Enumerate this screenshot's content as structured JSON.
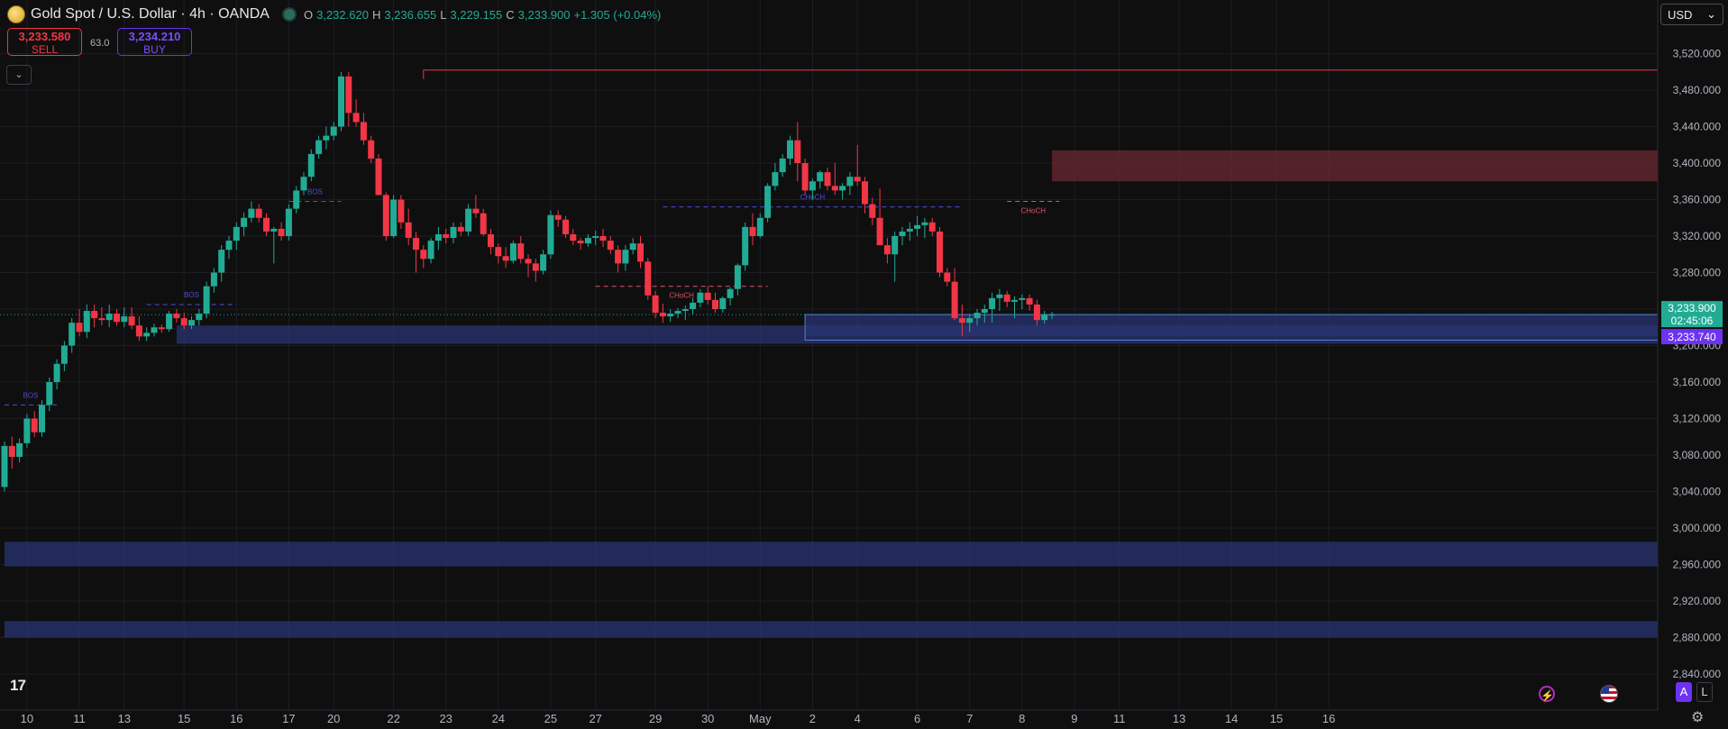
{
  "header": {
    "symbol": "Gold Spot / U.S. Dollar · 4h · OANDA",
    "open_label": "O",
    "open": "3,232.620",
    "high_label": "H",
    "high": "3,236.655",
    "low_label": "L",
    "low": "3,229.155",
    "close_label": "C",
    "close": "3,233.900",
    "change": "+1.305 (+0.04%)"
  },
  "trade": {
    "sell_price": "3,233.580",
    "sell_label": "SELL",
    "spread": "63.0",
    "buy_price": "3,234.210",
    "buy_label": "BUY"
  },
  "currency": "USD",
  "icons": {
    "collapse": "chevron-down-icon",
    "brand": "tradingview-logo",
    "bolt": "lightning-icon",
    "flag": "us-flag-icon",
    "settings": "gear-icon"
  },
  "labels": {
    "tv": "17",
    "auto": "A",
    "log": "L",
    "bolt": "⚡",
    "gear": "⚙"
  },
  "colors": {
    "up": "#22ab94",
    "down": "#f23645",
    "zone_blue": "#2a3472",
    "zone_red": "#6b2a30",
    "structure": "#4b4fd8",
    "accent": "#6d32f2"
  },
  "chart_data": {
    "type": "candlestick",
    "timeframe": "4h",
    "ylim": [
      2830,
      3540
    ],
    "y_ticks": [
      2840,
      2880,
      2920,
      2960,
      3000,
      3040,
      3080,
      3120,
      3160,
      3200,
      3240,
      3280,
      3320,
      3360,
      3400,
      3440,
      3480,
      3520
    ],
    "y_tick_labels": [
      "2,840.000",
      "2,880.000",
      "2,920.000",
      "2,960.000",
      "3,000.000",
      "3,040.000",
      "3,080.000",
      "3,120.000",
      "3,160.000",
      "3,200.000",
      "3,240.000",
      "3,280.000",
      "3,320.000",
      "3,360.000",
      "3,400.000",
      "3,440.000",
      "3,480.000",
      "3,520.000"
    ],
    "x_labels": [
      {
        "label": "10",
        "i": 3
      },
      {
        "label": "11",
        "i": 10
      },
      {
        "label": "13",
        "i": 16
      },
      {
        "label": "15",
        "i": 24
      },
      {
        "label": "16",
        "i": 31
      },
      {
        "label": "17",
        "i": 38
      },
      {
        "label": "20",
        "i": 44
      },
      {
        "label": "22",
        "i": 52
      },
      {
        "label": "23",
        "i": 59
      },
      {
        "label": "24",
        "i": 66
      },
      {
        "label": "25",
        "i": 73
      },
      {
        "label": "27",
        "i": 79
      },
      {
        "label": "29",
        "i": 87
      },
      {
        "label": "30",
        "i": 94
      },
      {
        "label": "May",
        "i": 101
      },
      {
        "label": "2",
        "i": 108
      },
      {
        "label": "4",
        "i": 114
      },
      {
        "label": "6",
        "i": 122
      },
      {
        "label": "7",
        "i": 129
      },
      {
        "label": "8",
        "i": 136
      },
      {
        "label": "9",
        "i": 143
      },
      {
        "label": "11",
        "i": 149
      },
      {
        "label": "13",
        "i": 157
      },
      {
        "label": "14",
        "i": 164
      },
      {
        "label": "15",
        "i": 170
      },
      {
        "label": "16",
        "i": 177
      }
    ],
    "candles": [
      [
        3045,
        3095,
        3040,
        3090
      ],
      [
        3090,
        3100,
        3065,
        3078
      ],
      [
        3078,
        3098,
        3072,
        3093
      ],
      [
        3093,
        3125,
        3088,
        3120
      ],
      [
        3120,
        3128,
        3100,
        3105
      ],
      [
        3105,
        3140,
        3100,
        3135
      ],
      [
        3135,
        3165,
        3128,
        3160
      ],
      [
        3160,
        3185,
        3152,
        3180
      ],
      [
        3180,
        3205,
        3172,
        3200
      ],
      [
        3200,
        3230,
        3192,
        3225
      ],
      [
        3225,
        3240,
        3210,
        3215
      ],
      [
        3215,
        3245,
        3208,
        3238
      ],
      [
        3238,
        3245,
        3220,
        3230
      ],
      [
        3230,
        3242,
        3222,
        3228
      ],
      [
        3228,
        3245,
        3220,
        3235
      ],
      [
        3235,
        3240,
        3222,
        3226
      ],
      [
        3226,
        3242,
        3220,
        3232
      ],
      [
        3232,
        3242,
        3218,
        3222
      ],
      [
        3222,
        3232,
        3205,
        3210
      ],
      [
        3210,
        3220,
        3205,
        3214
      ],
      [
        3214,
        3224,
        3210,
        3220
      ],
      [
        3220,
        3223,
        3214,
        3218
      ],
      [
        3218,
        3238,
        3215,
        3235
      ],
      [
        3235,
        3240,
        3225,
        3230
      ],
      [
        3230,
        3236,
        3218,
        3222
      ],
      [
        3222,
        3232,
        3218,
        3228
      ],
      [
        3228,
        3240,
        3222,
        3235
      ],
      [
        3235,
        3270,
        3230,
        3265
      ],
      [
        3265,
        3285,
        3258,
        3280
      ],
      [
        3280,
        3310,
        3270,
        3305
      ],
      [
        3305,
        3320,
        3295,
        3315
      ],
      [
        3315,
        3335,
        3305,
        3330
      ],
      [
        3330,
        3346,
        3320,
        3340
      ],
      [
        3340,
        3358,
        3335,
        3350
      ],
      [
        3350,
        3355,
        3335,
        3340
      ],
      [
        3340,
        3345,
        3320,
        3325
      ],
      [
        3325,
        3330,
        3290,
        3328
      ],
      [
        3328,
        3335,
        3315,
        3320
      ],
      [
        3320,
        3355,
        3315,
        3350
      ],
      [
        3350,
        3375,
        3345,
        3370
      ],
      [
        3370,
        3390,
        3365,
        3385
      ],
      [
        3385,
        3415,
        3380,
        3410
      ],
      [
        3410,
        3430,
        3405,
        3425
      ],
      [
        3425,
        3440,
        3415,
        3430
      ],
      [
        3430,
        3445,
        3425,
        3440
      ],
      [
        3440,
        3500,
        3435,
        3495
      ],
      [
        3495,
        3500,
        3440,
        3455
      ],
      [
        3455,
        3470,
        3440,
        3445
      ],
      [
        3445,
        3455,
        3420,
        3425
      ],
      [
        3425,
        3430,
        3400,
        3405
      ],
      [
        3405,
        3410,
        3370,
        3365
      ],
      [
        3365,
        3368,
        3315,
        3320
      ],
      [
        3320,
        3365,
        3318,
        3360
      ],
      [
        3360,
        3365,
        3328,
        3335
      ],
      [
        3335,
        3350,
        3310,
        3318
      ],
      [
        3318,
        3325,
        3280,
        3305
      ],
      [
        3305,
        3310,
        3285,
        3295
      ],
      [
        3295,
        3318,
        3290,
        3315
      ],
      [
        3315,
        3330,
        3305,
        3322
      ],
      [
        3322,
        3328,
        3312,
        3318
      ],
      [
        3318,
        3335,
        3312,
        3330
      ],
      [
        3330,
        3335,
        3320,
        3325
      ],
      [
        3325,
        3355,
        3320,
        3350
      ],
      [
        3350,
        3365,
        3340,
        3345
      ],
      [
        3345,
        3350,
        3320,
        3322
      ],
      [
        3322,
        3328,
        3300,
        3308
      ],
      [
        3308,
        3312,
        3290,
        3298
      ],
      [
        3298,
        3308,
        3285,
        3293
      ],
      [
        3293,
        3315,
        3290,
        3312
      ],
      [
        3312,
        3320,
        3290,
        3295
      ],
      [
        3295,
        3300,
        3275,
        3290
      ],
      [
        3290,
        3295,
        3270,
        3282
      ],
      [
        3282,
        3305,
        3278,
        3300
      ],
      [
        3300,
        3348,
        3295,
        3343
      ],
      [
        3343,
        3348,
        3330,
        3338
      ],
      [
        3338,
        3342,
        3318,
        3322
      ],
      [
        3322,
        3328,
        3310,
        3315
      ],
      [
        3315,
        3318,
        3305,
        3312
      ],
      [
        3312,
        3322,
        3308,
        3318
      ],
      [
        3318,
        3326,
        3310,
        3320
      ],
      [
        3320,
        3328,
        3308,
        3315
      ],
      [
        3315,
        3320,
        3300,
        3305
      ],
      [
        3305,
        3310,
        3280,
        3290
      ],
      [
        3290,
        3310,
        3282,
        3305
      ],
      [
        3305,
        3318,
        3300,
        3312
      ],
      [
        3312,
        3320,
        3285,
        3292
      ],
      [
        3292,
        3296,
        3250,
        3255
      ],
      [
        3255,
        3260,
        3230,
        3236
      ],
      [
        3236,
        3246,
        3225,
        3232
      ],
      [
        3232,
        3240,
        3226,
        3235
      ],
      [
        3235,
        3241,
        3230,
        3238
      ],
      [
        3238,
        3244,
        3228,
        3240
      ],
      [
        3240,
        3252,
        3234,
        3247
      ],
      [
        3247,
        3262,
        3242,
        3258
      ],
      [
        3258,
        3265,
        3245,
        3250
      ],
      [
        3250,
        3258,
        3236,
        3240
      ],
      [
        3240,
        3254,
        3236,
        3252
      ],
      [
        3252,
        3264,
        3244,
        3262
      ],
      [
        3262,
        3290,
        3255,
        3288
      ],
      [
        3288,
        3335,
        3282,
        3330
      ],
      [
        3330,
        3345,
        3310,
        3320
      ],
      [
        3320,
        3345,
        3318,
        3340
      ],
      [
        3340,
        3378,
        3335,
        3375
      ],
      [
        3375,
        3400,
        3370,
        3390
      ],
      [
        3390,
        3410,
        3385,
        3405
      ],
      [
        3405,
        3430,
        3398,
        3425
      ],
      [
        3425,
        3445,
        3380,
        3400
      ],
      [
        3400,
        3405,
        3365,
        3370
      ],
      [
        3370,
        3383,
        3360,
        3380
      ],
      [
        3380,
        3392,
        3372,
        3390
      ],
      [
        3390,
        3395,
        3370,
        3375
      ],
      [
        3375,
        3400,
        3365,
        3370
      ],
      [
        3370,
        3378,
        3360,
        3375
      ],
      [
        3375,
        3390,
        3365,
        3385
      ],
      [
        3385,
        3420,
        3375,
        3380
      ],
      [
        3380,
        3385,
        3345,
        3355
      ],
      [
        3355,
        3362,
        3332,
        3340
      ],
      [
        3340,
        3372,
        3335,
        3310
      ],
      [
        3310,
        3318,
        3290,
        3300
      ],
      [
        3300,
        3325,
        3270,
        3320
      ],
      [
        3320,
        3330,
        3310,
        3325
      ],
      [
        3325,
        3335,
        3315,
        3328
      ],
      [
        3328,
        3342,
        3320,
        3332
      ],
      [
        3332,
        3340,
        3318,
        3335
      ],
      [
        3335,
        3340,
        3320,
        3325
      ],
      [
        3325,
        3330,
        3275,
        3280
      ],
      [
        3280,
        3285,
        3265,
        3270
      ],
      [
        3270,
        3285,
        3228,
        3230
      ],
      [
        3230,
        3245,
        3210,
        3225
      ],
      [
        3225,
        3234,
        3215,
        3230
      ],
      [
        3230,
        3240,
        3222,
        3236
      ],
      [
        3236,
        3245,
        3225,
        3240
      ],
      [
        3240,
        3258,
        3225,
        3252
      ],
      [
        3252,
        3262,
        3238,
        3256
      ],
      [
        3256,
        3260,
        3242,
        3248
      ],
      [
        3248,
        3254,
        3230,
        3250
      ],
      [
        3250,
        3256,
        3240,
        3252
      ],
      [
        3252,
        3256,
        3238,
        3245
      ],
      [
        3245,
        3250,
        3222,
        3228
      ],
      [
        3228,
        3238,
        3224,
        3234
      ],
      [
        3234,
        3237,
        3229,
        3234
      ]
    ],
    "zones": [
      {
        "from_i": 23,
        "to": "right",
        "y_low": 3202,
        "y_high": 3222,
        "color": "blue"
      },
      {
        "from_i": 0,
        "to": "right",
        "y_low": 2958,
        "y_high": 2985,
        "color": "blue"
      },
      {
        "from_i": 0,
        "to": "right",
        "y_low": 2880,
        "y_high": 2898,
        "color": "blue"
      },
      {
        "from_i": 107,
        "to": "right",
        "y_low": 3210,
        "y_high": 3234,
        "color": "blue"
      },
      {
        "from_i": 140,
        "to": "right",
        "y_low": 3380,
        "y_high": 3414,
        "color": "red"
      }
    ],
    "resistance": {
      "from_i": 56,
      "value": 3502
    },
    "support_line": {
      "from_i": 107,
      "value": 3206
    },
    "structure": [
      {
        "label": "BOS",
        "from_i": 0,
        "to_i": 7,
        "value": 3135,
        "color": "blue"
      },
      {
        "label": "BOS",
        "from_i": 19,
        "to_i": 31,
        "value": 3245,
        "color": "blue"
      },
      {
        "label": "BOS",
        "from_i": 38,
        "to_i": 45,
        "value": 3358,
        "color": "blue"
      },
      {
        "label": "CHoCH",
        "from_i": 79,
        "to_i": 102,
        "value": 3265,
        "color": "red"
      },
      {
        "label": "CHoCH",
        "from_i": 88,
        "to_i": 128,
        "value": 3352,
        "color": "blue"
      },
      {
        "label": "CHoCH",
        "from_i": 134,
        "to_i": 141,
        "value": 3358,
        "color": "red"
      }
    ],
    "price_labels": [
      {
        "value": "3,233.900",
        "timer": "02:45:06",
        "color": "#22ab94"
      },
      {
        "value": "3,233.740",
        "color": "#6d32f2"
      }
    ]
  }
}
